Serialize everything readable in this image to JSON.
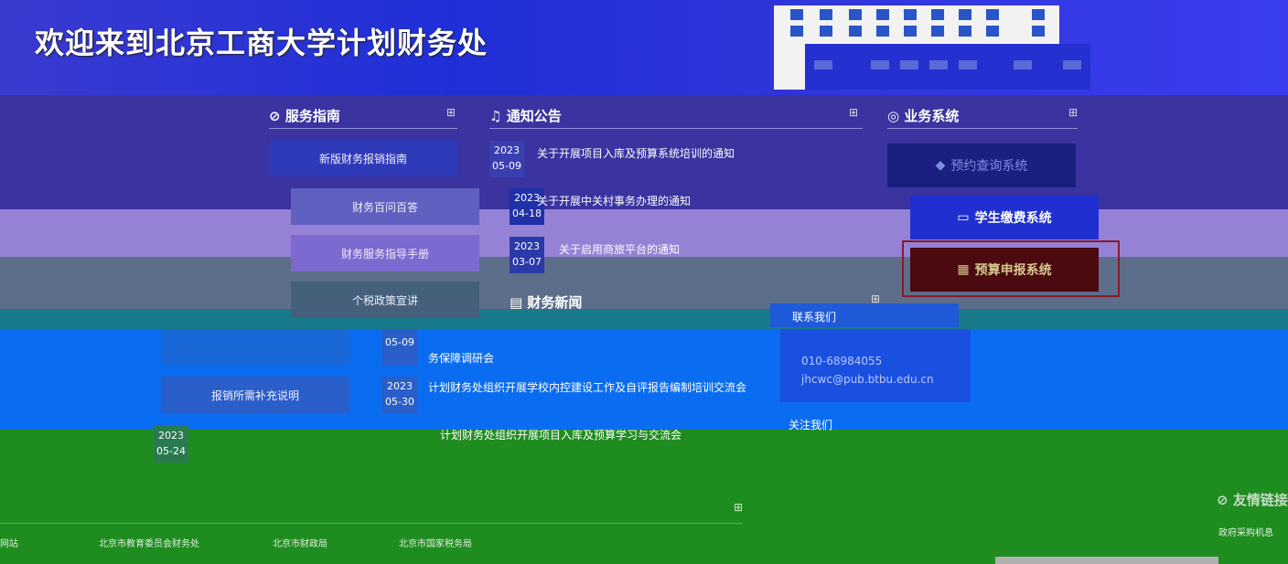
{
  "header": {
    "welcome": "欢迎来到北京工商大学计划财务处"
  },
  "guide": {
    "title": "服务指南",
    "items": [
      "新版财务报销指南",
      "财务百问百答",
      "财务服务指导手册",
      "个税政策宣讲",
      "",
      "报销所需补充说明"
    ]
  },
  "notice": {
    "title": "通知公告",
    "items": [
      {
        "year": "2023",
        "date": "05-09",
        "text": "关于开展项目入库及预算系统培训的通知"
      },
      {
        "year": "2023",
        "date": "04-18",
        "text": "关于开展中关村事务办理的通知"
      },
      {
        "year": "2023",
        "date": "03-07",
        "text": "关于启用商旅平台的通知"
      }
    ]
  },
  "news": {
    "title": "财务新闻",
    "items": [
      {
        "year": "",
        "date": "05-09",
        "text": "务保障调研会"
      },
      {
        "year": "2023",
        "date": "05-30",
        "text": "计划财务处组织开展学校内控建设工作及自评报告编制培训交流会"
      },
      {
        "year": "2023",
        "date": "05-24",
        "text": "计划财务处组织开展项目入库及预算学习与交流会"
      }
    ]
  },
  "systems": {
    "title": "业务系统",
    "items": [
      "预约查询系统",
      "学生缴费系统",
      "预算申报系统"
    ]
  },
  "contact": {
    "title": "联系我们",
    "phone": "010-68984055",
    "email": "jhcwc@pub.btbu.edu.cn",
    "follow": "关注我们"
  },
  "links": {
    "title": "友情链接",
    "items": [
      "网站",
      "北京市教育委员会财务处",
      "北京市财政局",
      "北京市国家税务局"
    ],
    "right_item": "政府采购机息"
  }
}
